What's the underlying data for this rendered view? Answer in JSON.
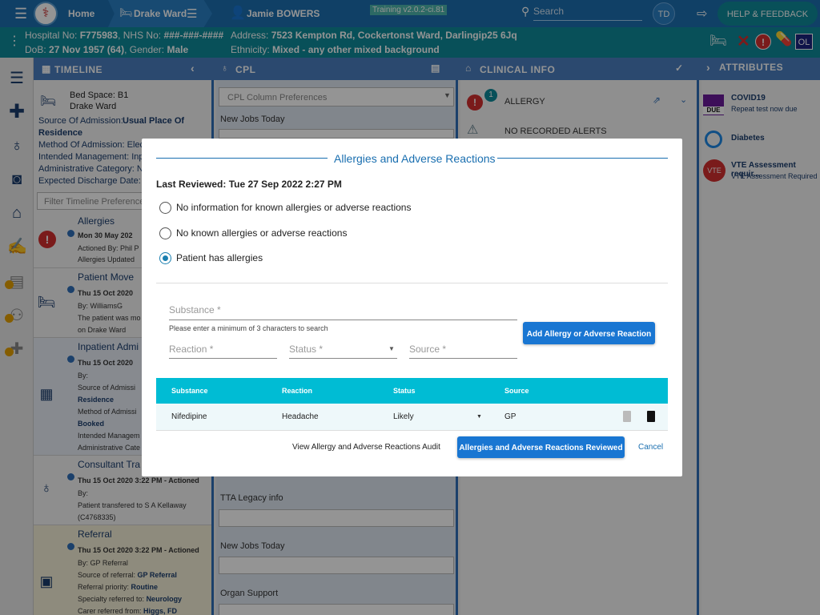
{
  "topbar": {
    "home": "Home",
    "ward": "Drake Ward",
    "patient": "Jamie BOWERS",
    "version": "Training v2.0.2-ci.81",
    "search_placeholder": "Search",
    "user_initials": "TD",
    "help": "HELP & FEEDBACK"
  },
  "patient": {
    "hospital_no_label": "Hospital No:",
    "hospital_no": "F775983",
    "nhs_label": ", NHS No:",
    "nhs_no": "###-###-####",
    "dob_label": "DoB:",
    "dob": "27 Nov 1957 (64)",
    "gender_label": ", Gender:",
    "gender": "Male",
    "address_label": "Address:",
    "address": "7523 Kempton Rd, Cockertonst Ward, Darlingip25 6Jq",
    "ethnicity_label": "Ethnicity:",
    "ethnicity": "Mixed - any other mixed background",
    "badge_ol": "OL"
  },
  "panels": {
    "timeline": "TIMELINE",
    "cpl": "CPL",
    "clinical": "CLINICAL INFO",
    "attributes": "ATTRIBUTES"
  },
  "timeline": {
    "bed_space": "Bed Space: B1",
    "ward": "Drake Ward",
    "source_label": "Source Of Admission:",
    "source_value": "Usual Place Of",
    "source_value2": "Residence",
    "method": "Method Of Admission: Elec",
    "intended": "Intended Management: Inpa",
    "admin": "Administrative Category: NI",
    "discharge": "Expected Discharge Date: F",
    "filter_placeholder": "Filter Timeline Preferences",
    "entries": [
      {
        "title": "Allergies",
        "date": "Mon 30 May 202",
        "l1": "Actioned By: Phil P",
        "l2": "Allergies Updated"
      },
      {
        "title": "Patient Move",
        "date": "Thu 15 Oct 2020",
        "l1": "By: WilliamsG",
        "l2": "The patient was mo",
        "l3": "on Drake Ward"
      },
      {
        "title": "Inpatient Admi",
        "date": "Thu 15 Oct 2020",
        "l1": "By:",
        "l2": "Source of Admissi",
        "l3": "Residence",
        "l4": "Method of Admissi",
        "l5": "Booked",
        "l6": "Intended Managem",
        "l7": "Administrative Cate"
      },
      {
        "title": "Consultant Tra",
        "date": "Thu 15 Oct 2020 3:22 PM - Actioned",
        "l1": "By:",
        "l2": "Patient transfered to S A Kellaway",
        "l3": "(C4768335)"
      },
      {
        "title": "Referral",
        "date": "Thu 15 Oct 2020 3:22 PM - Actioned",
        "l1": "By: GP Referral",
        "l2": "Source of referral:",
        "l2b": "GP Referral",
        "l3": "Referral priority:",
        "l3b": "Routine",
        "l4": "Specialty referred to:",
        "l4b": "Neurology",
        "l5": "Carer referred from:",
        "l5b": "Higgs, FD"
      }
    ]
  },
  "cpl": {
    "preferences": "CPL Column Preferences",
    "new_jobs": "New Jobs Today",
    "tta": "TTA Legacy info",
    "new_jobs2": "New Jobs Today",
    "organ": "Organ Support"
  },
  "clinical": {
    "allergy_count": "1",
    "allergy": "ALLERGY",
    "alerts": "NO RECORDED ALERTS"
  },
  "attributes": {
    "items": [
      {
        "title": "COVID19",
        "sub": "Repeat test now due",
        "badge": "DUE"
      },
      {
        "title": "Diabetes",
        "sub": ""
      },
      {
        "title": "VTE Assessment requir...",
        "sub": "VTE Assessment Required",
        "badge": "VTE"
      }
    ]
  },
  "modal": {
    "title": "Allergies and Adverse Reactions",
    "last_reviewed": "Last Reviewed: Tue 27 Sep 2022 2:27 PM",
    "options": [
      {
        "label": "No information for known allergies or adverse reactions",
        "checked": false
      },
      {
        "label": "No known allergies or adverse reactions",
        "checked": false
      },
      {
        "label": "Patient has allergies",
        "checked": true
      }
    ],
    "substance_label": "Substance *",
    "substance_hint": "Please enter a minimum of 3 characters to search",
    "reaction_label": "Reaction *",
    "status_label": "Status *",
    "source_label": "Source *",
    "add_button": "Add Allergy or Adverse Reaction",
    "table": {
      "headers": [
        "Substance",
        "Reaction",
        "Status",
        "Source"
      ],
      "rows": [
        {
          "substance": "Nifedipine",
          "reaction": "Headache",
          "status": "Likely",
          "source": "GP"
        }
      ]
    },
    "audit_link": "View Allergy and Adverse Reactions Audit",
    "reviewed_button": "Allergies and Adverse Reactions Reviewed",
    "cancel": "Cancel"
  },
  "colors": {
    "topbar": "#1c6fb0",
    "patientbar": "#0e8a99",
    "table_header": "#00bcd4",
    "primary_button": "#1976d2",
    "alert_red": "#d32f2f"
  }
}
